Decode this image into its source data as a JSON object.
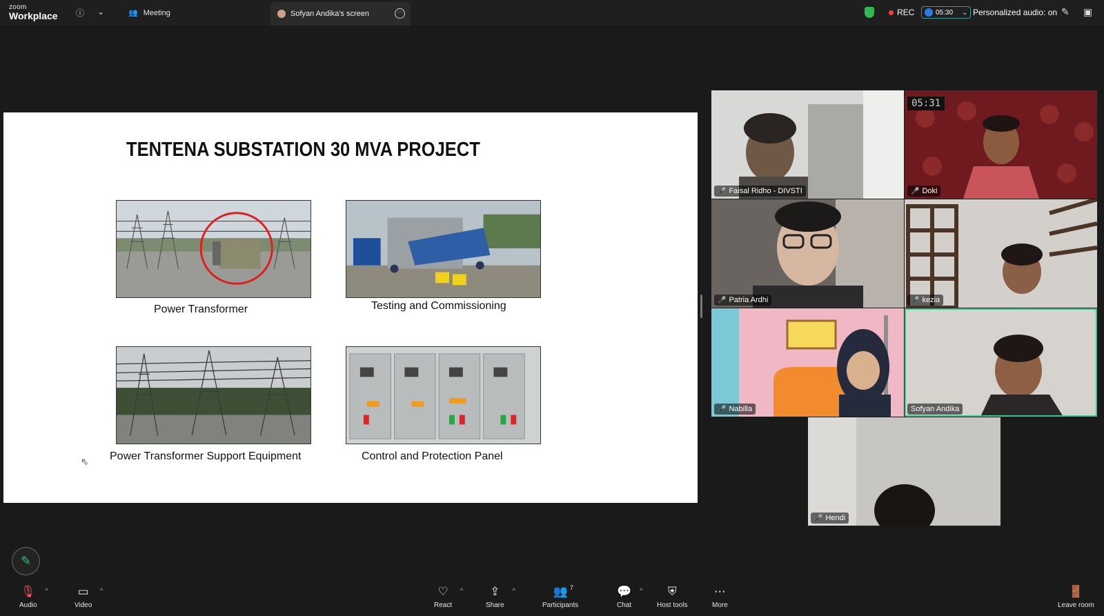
{
  "app": {
    "logo_small": "zoom",
    "logo_big": "Workplace"
  },
  "topbar": {
    "meeting_label": "Meeting",
    "screen_tab_label": "Sofyan Andika's screen",
    "rec_label": "REC",
    "timer": "05:30",
    "personalized_audio": "Personalized audio: on"
  },
  "slide": {
    "title": "TENTENA SUBSTATION 30 MVA PROJECT",
    "captions": [
      "Power Transformer",
      "Testing and Commissioning",
      "Power Transformer Support Equipment",
      "Control and Protection Panel"
    ]
  },
  "participants": [
    {
      "name": "Faisal Ridho - DIVSTI",
      "muted": true
    },
    {
      "name": "Doki",
      "muted": true,
      "recording_clock": "05:31"
    },
    {
      "name": "Patria Ardhi",
      "muted": true
    },
    {
      "name": "kezia",
      "muted": true
    },
    {
      "name": "Nabilla",
      "muted": true
    },
    {
      "name": "Sofyan Andika",
      "muted": false,
      "active_speaker": true
    },
    {
      "name": "Hendi",
      "muted": true
    }
  ],
  "toolbar": {
    "audio": "Audio",
    "video": "Video",
    "react": "React",
    "share": "Share",
    "participants": "Participants",
    "participants_count": "7",
    "chat": "Chat",
    "host_tools": "Host tools",
    "more": "More",
    "leave": "Leave room"
  },
  "colors": {
    "accent_green": "#35c98a",
    "muted_red": "#ff4d4d",
    "rec_red": "#ff3b3b"
  }
}
